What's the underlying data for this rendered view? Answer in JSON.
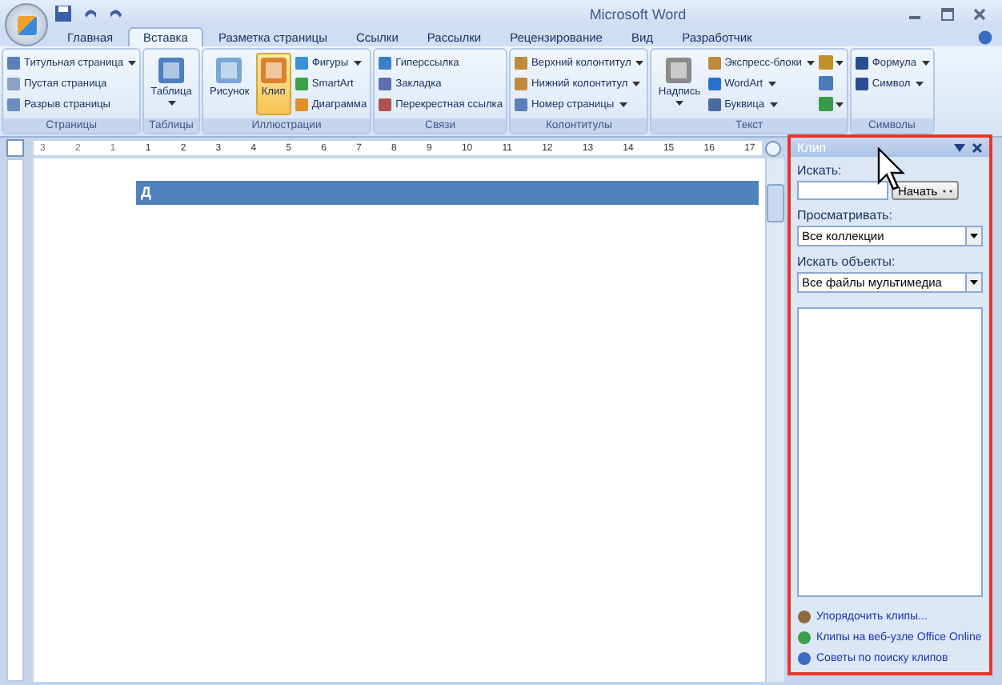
{
  "window": {
    "title": "Microsoft Word"
  },
  "tabs": [
    {
      "label": "Главная",
      "selected": false
    },
    {
      "label": "Вставка",
      "selected": true
    },
    {
      "label": "Разметка страницы",
      "selected": false
    },
    {
      "label": "Ссылки",
      "selected": false
    },
    {
      "label": "Рассылки",
      "selected": false
    },
    {
      "label": "Рецензирование",
      "selected": false
    },
    {
      "label": "Вид",
      "selected": false
    },
    {
      "label": "Разработчик",
      "selected": false
    }
  ],
  "ribbon_groups": [
    {
      "label": "Страницы",
      "items": [
        {
          "kind": "small",
          "label": "Титульная страница",
          "dropdown": true
        },
        {
          "kind": "small",
          "label": "Пустая страница",
          "dropdown": false
        },
        {
          "kind": "small",
          "label": "Разрыв страницы",
          "dropdown": false
        }
      ]
    },
    {
      "label": "Таблицы",
      "items": [
        {
          "kind": "large",
          "label": "Таблица",
          "dropdown": true,
          "selected": false
        }
      ]
    },
    {
      "label": "Иллюстрации",
      "items": [
        {
          "kind": "large",
          "label": "Рисунок",
          "dropdown": false,
          "selected": false
        },
        {
          "kind": "large",
          "label": "Клип",
          "dropdown": false,
          "selected": true
        },
        {
          "kind": "small",
          "label": "Фигуры",
          "dropdown": true
        },
        {
          "kind": "small",
          "label": "SmartArt",
          "dropdown": false
        },
        {
          "kind": "small",
          "label": "Диаграмма",
          "dropdown": false
        }
      ]
    },
    {
      "label": "Связи",
      "items": [
        {
          "kind": "small",
          "label": "Гиперссылка",
          "dropdown": false
        },
        {
          "kind": "small",
          "label": "Закладка",
          "dropdown": false
        },
        {
          "kind": "small",
          "label": "Перекрестная ссылка",
          "dropdown": false
        }
      ]
    },
    {
      "label": "Колонтитулы",
      "items": [
        {
          "kind": "small",
          "label": "Верхний колонтитул",
          "dropdown": true
        },
        {
          "kind": "small",
          "label": "Нижний колонтитул",
          "dropdown": true
        },
        {
          "kind": "small",
          "label": "Номер страницы",
          "dropdown": true
        }
      ]
    },
    {
      "label": "Текст",
      "items": [
        {
          "kind": "large",
          "label": "Надпись",
          "dropdown": true,
          "selected": false
        },
        {
          "kind": "small",
          "label": "Экспресс-блоки",
          "dropdown": true
        },
        {
          "kind": "small",
          "label": "WordArt",
          "dropdown": true
        },
        {
          "kind": "small",
          "label": "Буквица",
          "dropdown": true
        },
        {
          "kind": "tiny",
          "dropdown": true
        },
        {
          "kind": "tiny",
          "dropdown": false
        },
        {
          "kind": "tiny",
          "dropdown": true
        }
      ]
    },
    {
      "label": "Символы",
      "items": [
        {
          "kind": "small",
          "label": "Формула",
          "dropdown": true
        },
        {
          "kind": "small",
          "label": "Символ",
          "dropdown": true
        }
      ]
    }
  ],
  "ruler": {
    "labels": [
      "3",
      "2",
      "1",
      "1",
      "2",
      "3",
      "4",
      "5",
      "6",
      "7",
      "8",
      "9",
      "10",
      "11",
      "12",
      "13",
      "14",
      "15",
      "16",
      "17"
    ]
  },
  "document": {
    "heading": "Д"
  },
  "task_pane": {
    "title": "Клип",
    "search_label": "Искать:",
    "search_button": "Начать",
    "browse_label": "Просматривать:",
    "browse_value": "Все коллекции",
    "types_label": "Искать объекты:",
    "types_value": "Все файлы мультимедиа",
    "links": [
      {
        "label": "Упорядочить клипы..."
      },
      {
        "label": "Клипы на веб-узле Office Online"
      },
      {
        "label": "Советы по поиску клипов"
      }
    ]
  }
}
